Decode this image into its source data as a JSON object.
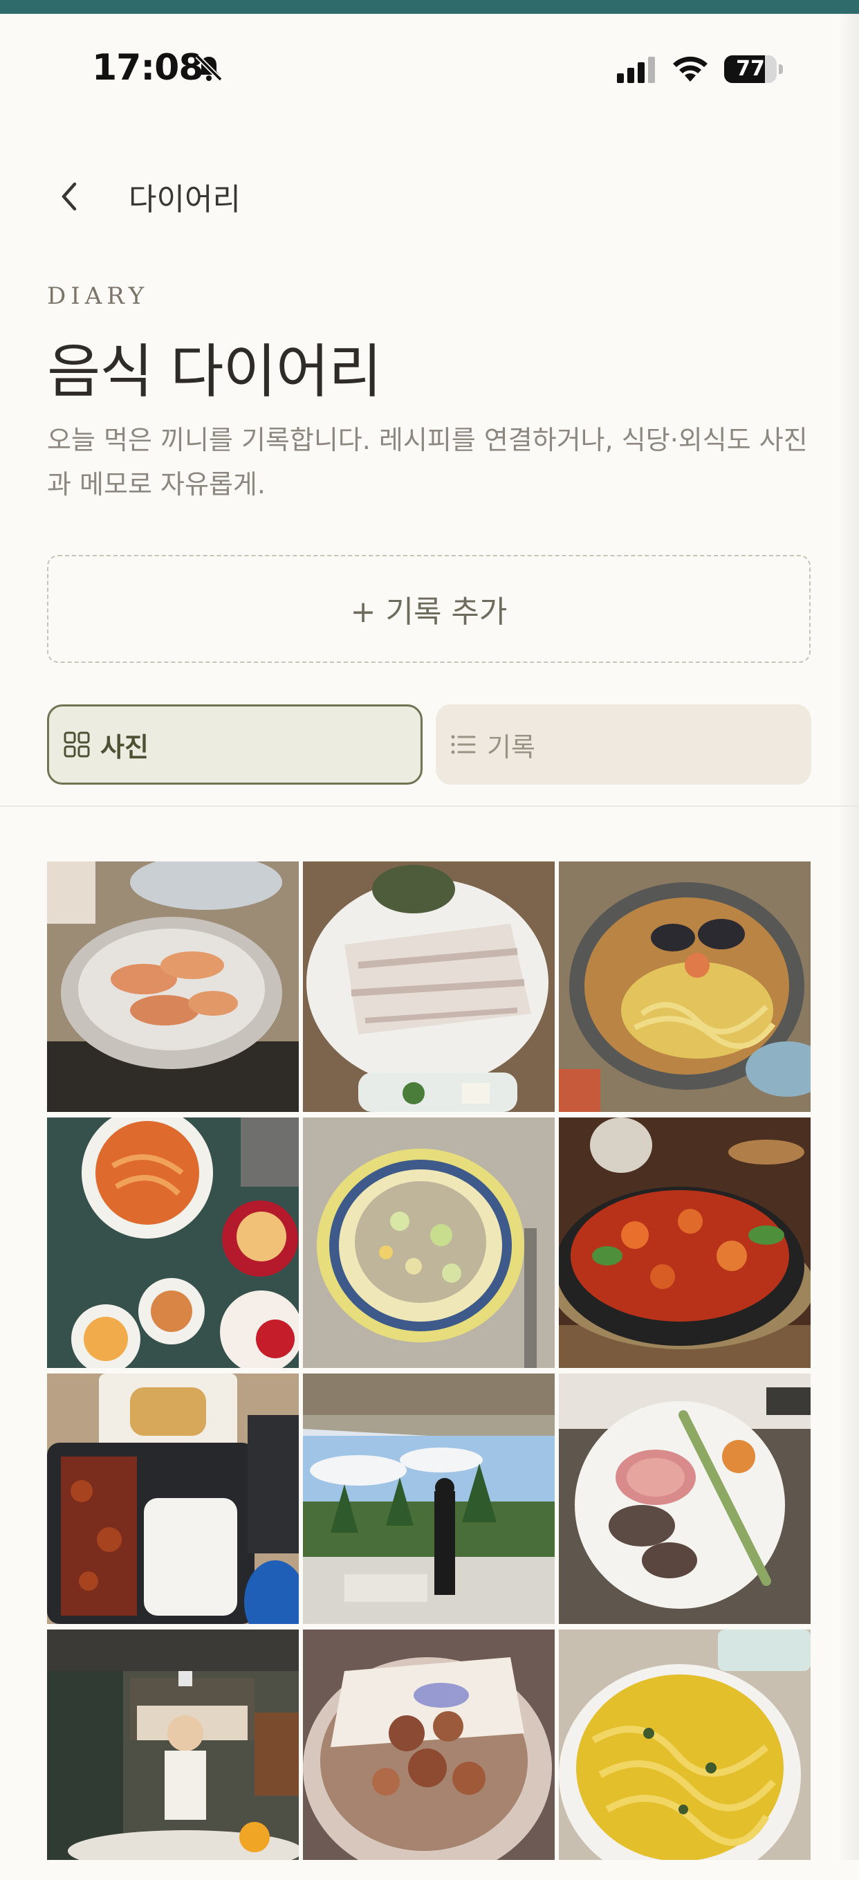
{
  "status_bar": {
    "time": "17:08",
    "battery": "77",
    "battery_level": 0.77
  },
  "header": {
    "back_label": "back",
    "title": "다이어리"
  },
  "hero": {
    "eyebrow": "DIARY",
    "title": "음식 다이어리",
    "description": "오늘 먹은 끼니를 기록합니다. 레시피를 연결하거나, 식당·외식도 사진과 메모로 자유롭게."
  },
  "add_button": {
    "label": "+ 기록 추가"
  },
  "view_toggle": {
    "photo": {
      "label": "사진",
      "icon": "grid-icon",
      "selected": true
    },
    "record": {
      "label": "기록",
      "icon": "list-icon",
      "selected": false
    }
  },
  "photos": [
    {
      "name": "grilled-shrimp",
      "bg": "#9c8b75"
    },
    {
      "name": "sliced-raw-fish",
      "bg": "#c9c1b4"
    },
    {
      "name": "seafood-ramen",
      "bg": "#8a7a62"
    },
    {
      "name": "korean-side-dishes",
      "bg": "#36514c"
    },
    {
      "name": "fried-rice",
      "bg": "#b9b3a8"
    },
    {
      "name": "spicy-squid",
      "bg": "#4b3022"
    },
    {
      "name": "takeout-box",
      "bg": "#b8a184"
    },
    {
      "name": "restaurant-view",
      "bg": "#7a8f6d"
    },
    {
      "name": "lamb-plate",
      "bg": "#5f574e"
    },
    {
      "name": "restaurant-interior",
      "bg": "#4e5046"
    },
    {
      "name": "fried-crackers",
      "bg": "#6e5a54"
    },
    {
      "name": "yellow-noodles",
      "bg": "#c9bfb0"
    }
  ]
}
